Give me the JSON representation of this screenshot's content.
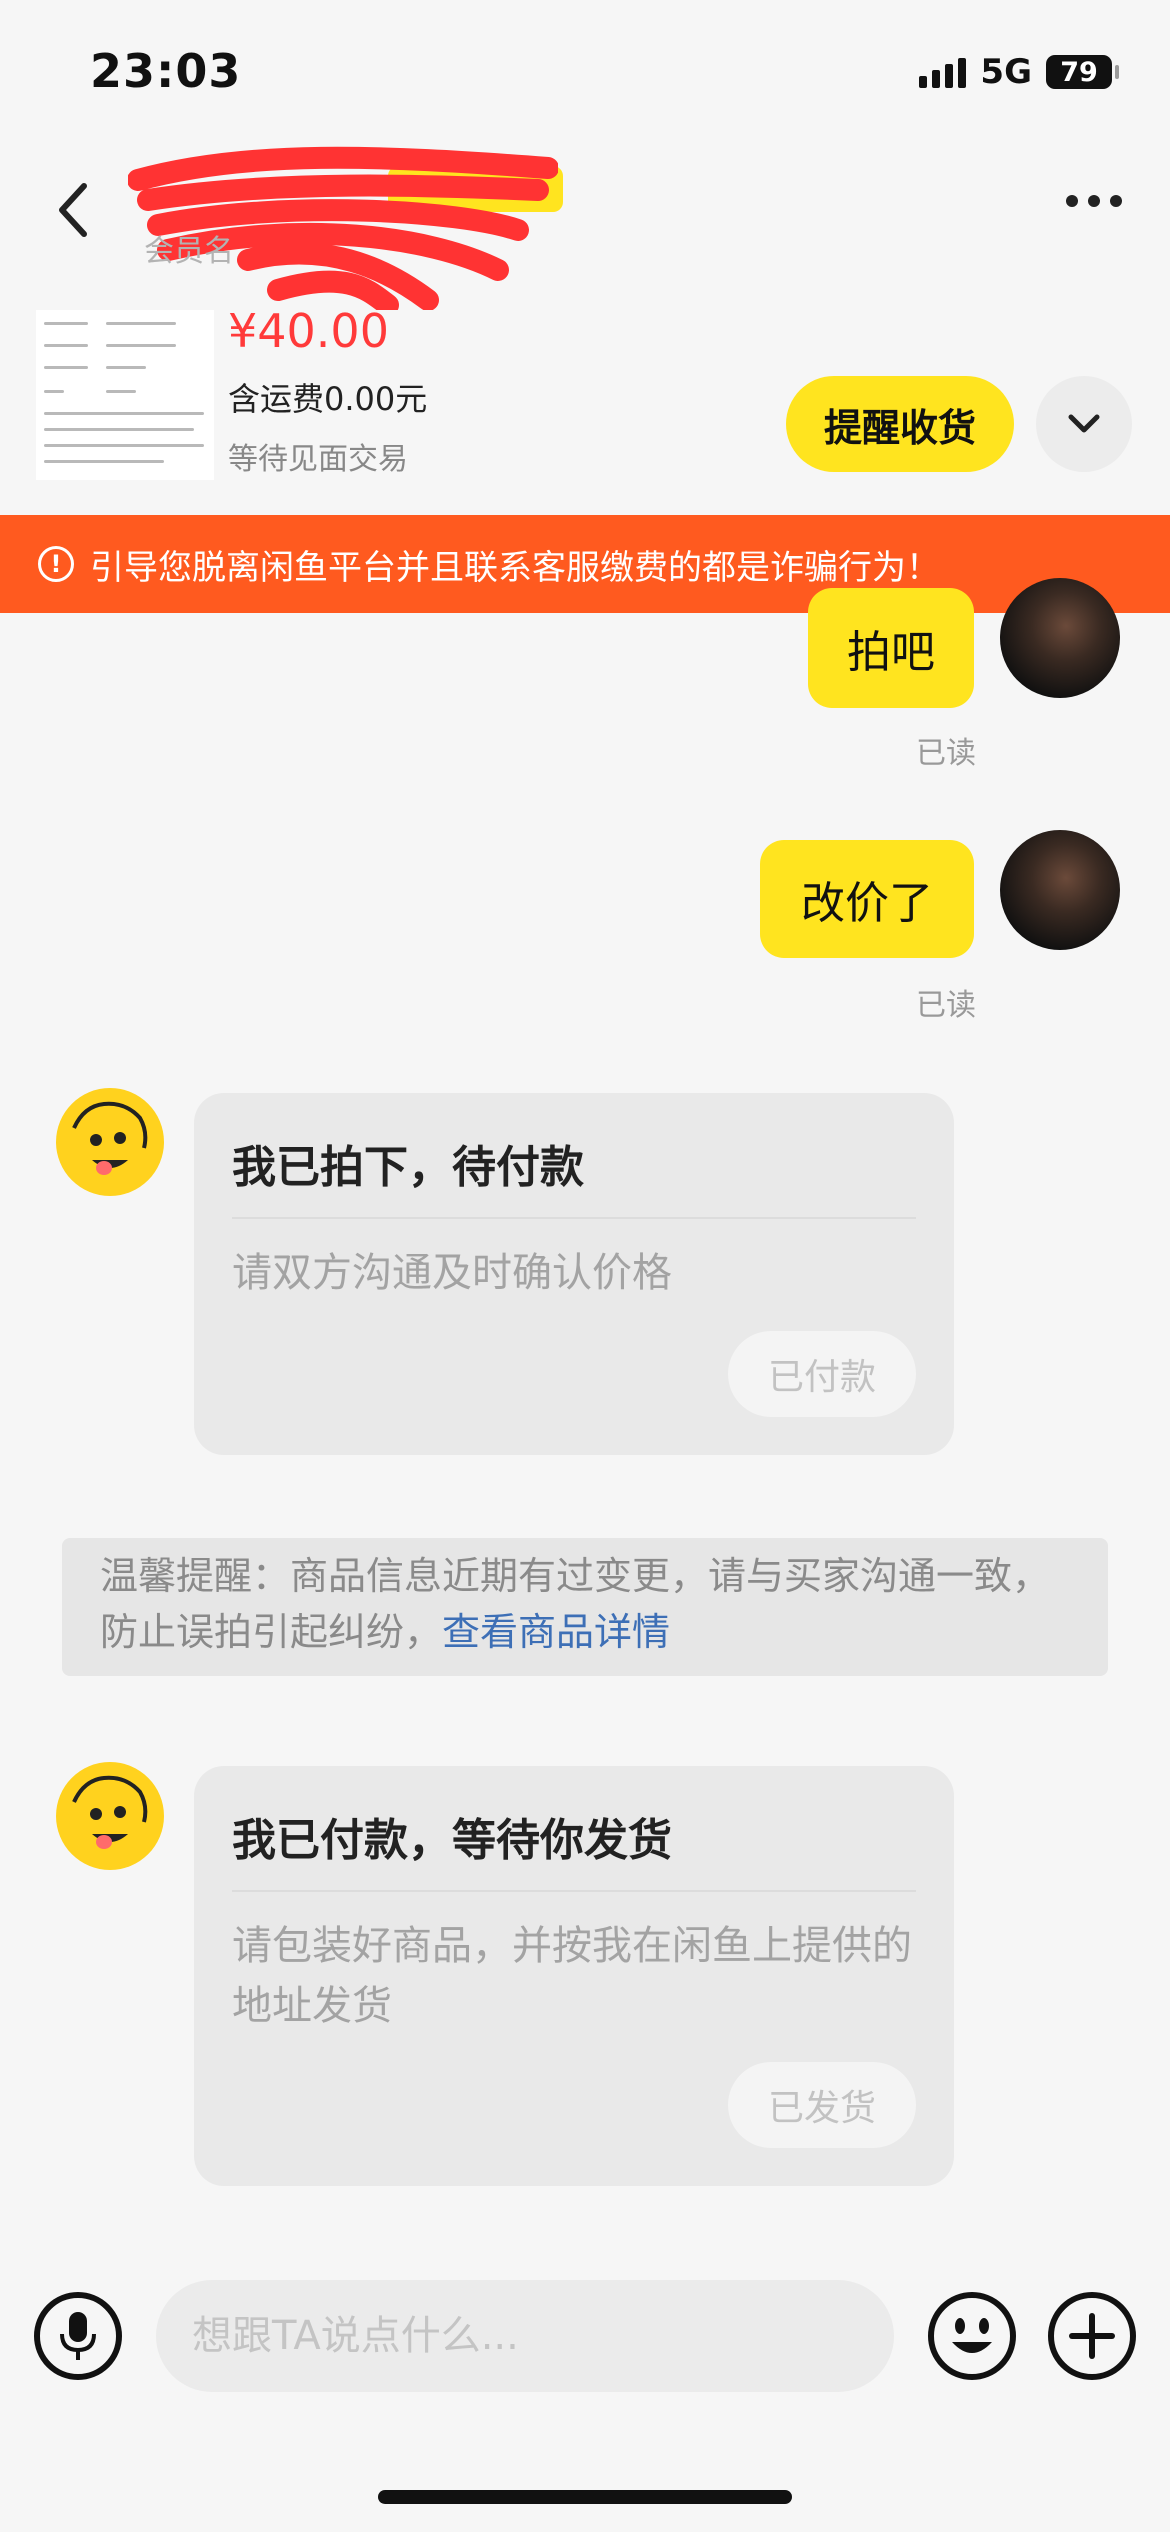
{
  "status_bar": {
    "time": "23:03",
    "network": "5G",
    "battery": "79"
  },
  "header": {
    "member_label": "会员名"
  },
  "product": {
    "price": "¥40.00",
    "shipping": "含运费0.00元",
    "status": "等待见面交易",
    "remind_button": "提醒收货"
  },
  "warning": {
    "text": "引导您脱离闲鱼平台并且联系客服缴费的都是诈骗行为！"
  },
  "messages": [
    {
      "text": "拍吧",
      "read": "已读"
    },
    {
      "text": "改价了",
      "read": "已读"
    }
  ],
  "cards": [
    {
      "title": "我已拍下，待付款",
      "desc": "请双方沟通及时确认价格",
      "button": "已付款"
    },
    {
      "title": "我已付款，等待你发货",
      "desc": "请包装好商品，并按我在闲鱼上提供的地址发货",
      "button": "已发货"
    }
  ],
  "notice": {
    "text": "温馨提醒：商品信息近期有过变更，请与买家沟通一致，防止误拍引起纠纷，",
    "link": "查看商品详情"
  },
  "input": {
    "placeholder": "想跟TA说点什么..."
  },
  "colors": {
    "accent": "#ffe41f",
    "warning": "#ff5a1f",
    "price": "#ff3a3a",
    "link": "#3d6fb6"
  }
}
